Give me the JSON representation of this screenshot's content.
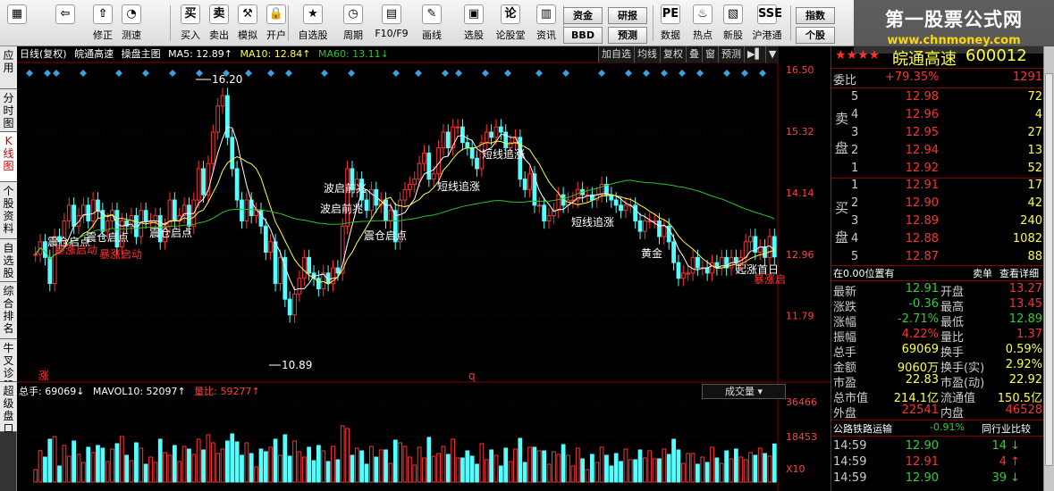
{
  "toolbar": {
    "items": [
      {
        "label": "",
        "icon": "windows-icon"
      },
      {
        "label": "",
        "icon": "back-arrow-icon"
      },
      {
        "label": "修正",
        "icon": "revise-icon"
      },
      {
        "label": "测速",
        "icon": "speedtest-icon"
      },
      {
        "label": "买入",
        "icon": "buy-icon"
      },
      {
        "label": "卖出",
        "icon": "sell-icon"
      },
      {
        "label": "模拟",
        "icon": "simulate-icon"
      },
      {
        "label": "开户",
        "icon": "lock-icon"
      },
      {
        "label": "自选股",
        "icon": "star-icon"
      },
      {
        "label": "周期",
        "icon": "clock-icon"
      },
      {
        "label": "F10/F9",
        "icon": "f10-icon"
      },
      {
        "label": "画线",
        "icon": "pen-icon"
      },
      {
        "label": "选股",
        "icon": "screen-icon"
      },
      {
        "label": "论股堂",
        "icon": "forum-icon"
      },
      {
        "label": "资讯",
        "icon": "news-icon"
      },
      {
        "label": "数据",
        "icon": "pe-icon"
      },
      {
        "label": "热点",
        "icon": "hot-icon"
      },
      {
        "label": "新股",
        "icon": "newstock-icon"
      },
      {
        "label": "沪港通",
        "icon": "sse-hk-icon"
      }
    ],
    "icon_glyphs": [
      "▦",
      "⇦",
      "⇧",
      "◔",
      "买",
      "卖",
      "⚒",
      "🔒",
      "★",
      "◷",
      "▤",
      "✎",
      "▣",
      "论",
      "▥",
      "PE",
      "♨",
      "▧",
      "SSE"
    ],
    "small_buttons": [
      "资金",
      "BBD",
      "研报",
      "预测",
      "指数",
      "个股"
    ]
  },
  "watermark": {
    "line1": "第一股票公式网",
    "line2": "www.chnmoney.com"
  },
  "left_tabs": [
    "应用",
    "分时图",
    "K线图",
    "个股资料",
    "自选股",
    "综合排名",
    "牛叉诊股",
    "超级盘口"
  ],
  "info_bar": {
    "period": "日线(复权)",
    "stock": "皖通高速",
    "template": "操盘主图",
    "ma5": "MA5: 12.89↑",
    "ma10": "MA10: 12.84↑",
    "ma60": "MA60: 13.11↓"
  },
  "chart_buttons": [
    "加自选",
    "均线",
    "复权",
    "叠",
    "窗",
    "预测",
    "▶▌",
    "▼"
  ],
  "price_axis": {
    "ticks": [
      "16.50",
      "15.32",
      "14.14",
      "12.96",
      "11.79"
    ]
  },
  "chart_data": {
    "type": "candlestick",
    "x": [
      1,
      2,
      3,
      4,
      5,
      6,
      7,
      8,
      9,
      10,
      11,
      12,
      13,
      14,
      15,
      16,
      17,
      18,
      19,
      20,
      21,
      22,
      23,
      24,
      25,
      26,
      27,
      28,
      29,
      30,
      31,
      32,
      33,
      34,
      35,
      36,
      37,
      38,
      39,
      40,
      41,
      42,
      43,
      44,
      45,
      46,
      47,
      48,
      49,
      50,
      51,
      52,
      53,
      54,
      55,
      56,
      57,
      58,
      59,
      60,
      61,
      62,
      63,
      64,
      65,
      66,
      67,
      68,
      69,
      70,
      71,
      72,
      73,
      74,
      75,
      76,
      77,
      78,
      79,
      80,
      81,
      82,
      83,
      84,
      85,
      86,
      87,
      88,
      89,
      90,
      91,
      92,
      93,
      94,
      95,
      96,
      97,
      98,
      99,
      100,
      101,
      102,
      103,
      104,
      105,
      106,
      107,
      108,
      109,
      110,
      111,
      112,
      113,
      114,
      115,
      116,
      117,
      118,
      119,
      120,
      121,
      122,
      123,
      124,
      125,
      126,
      127,
      128,
      129,
      130,
      131,
      132,
      133,
      134,
      135,
      136,
      137,
      138,
      139,
      140,
      141,
      142,
      143,
      144,
      145,
      146,
      147,
      148,
      149,
      150,
      151,
      152,
      153,
      154,
      155,
      156,
      157,
      158,
      159,
      160,
      161,
      162,
      163,
      164,
      165,
      166,
      167,
      168,
      169,
      170,
      171,
      172,
      173,
      174,
      175,
      176,
      177,
      178,
      179,
      180,
      181,
      182,
      183,
      184,
      185,
      186,
      187,
      188,
      189,
      190,
      191,
      192,
      193,
      194,
      195,
      196,
      197,
      198,
      199,
      200,
      201,
      202,
      203,
      204,
      205,
      206,
      207,
      208,
      209,
      210,
      211,
      212,
      213,
      214,
      215,
      216,
      217,
      218,
      219,
      220,
      221,
      222,
      223,
      224,
      225,
      226,
      227,
      228,
      229,
      230,
      231,
      232,
      233,
      234,
      235,
      236,
      237,
      238,
      239,
      240,
      241,
      242,
      243,
      244,
      245,
      246,
      247,
      248,
      249,
      250,
      251,
      252,
      253,
      254,
      255,
      256,
      257,
      258,
      259,
      260,
      261,
      262,
      263,
      264,
      265,
      266,
      267,
      268,
      269,
      270,
      271,
      272,
      273,
      274,
      275,
      276,
      277,
      278,
      279,
      280,
      281,
      282,
      283,
      284,
      285,
      286,
      287,
      288,
      289,
      290,
      291,
      292,
      293,
      294,
      295,
      296,
      297,
      298,
      299,
      300,
      301,
      302,
      303,
      304,
      305,
      306,
      307,
      308,
      309,
      310,
      311,
      312,
      313,
      314,
      315,
      316,
      317,
      318,
      319,
      320,
      321,
      322,
      323,
      324,
      325,
      326,
      327,
      328,
      329,
      330,
      331,
      332,
      333,
      334,
      335,
      336,
      337,
      338,
      339,
      340,
      341,
      342,
      343,
      344,
      345,
      346,
      347,
      348,
      349,
      350,
      351,
      352,
      353,
      354,
      355,
      356,
      357,
      358,
      359,
      360,
      361,
      362,
      363,
      364,
      365,
      366,
      367,
      368,
      369,
      370,
      371,
      372,
      373,
      374,
      375,
      376,
      377,
      378,
      379,
      380,
      381,
      382,
      383,
      384,
      385,
      386,
      387,
      388,
      389,
      390,
      391,
      392,
      393,
      394,
      395,
      396,
      397,
      398,
      399,
      400,
      401,
      402,
      403,
      404,
      405,
      406,
      407,
      408,
      409,
      410,
      411,
      412,
      413,
      414,
      415,
      416,
      417,
      418,
      419,
      420,
      421,
      422,
      423,
      424,
      425,
      426,
      427,
      428,
      429,
      430,
      431,
      432,
      433,
      434,
      435,
      436,
      437,
      438,
      439,
      440,
      441,
      442,
      443,
      444,
      445,
      446,
      447,
      448,
      449,
      450,
      451,
      452,
      453,
      454,
      455,
      456,
      457,
      458,
      459,
      460,
      461,
      462,
      463,
      464,
      465,
      466,
      467,
      468,
      469,
      470,
      471,
      472,
      473,
      474,
      475,
      476,
      477,
      478,
      479,
      480,
      481,
      482,
      483,
      484,
      485,
      486,
      487,
      488,
      489,
      490,
      491,
      492,
      493,
      494,
      495,
      496,
      497,
      498,
      499,
      500
    ],
    "closes": [
      12.96,
      13.2,
      12.9,
      12.4,
      13.3,
      13.2,
      13.6,
      13.9,
      13.5,
      13.7,
      13.9,
      13.6,
      14.0,
      13.8,
      13.4,
      13.6,
      13.8,
      13.1,
      13.6,
      13.5,
      13.7,
      13.3,
      13.8,
      13.6,
      13.6,
      13.7,
      13.2,
      13.5,
      14.0,
      13.6,
      13.7,
      13.9,
      13.5,
      14.0,
      14.6,
      14.1,
      14.7,
      15.3,
      15.8,
      16.0,
      15.2,
      14.6,
      14.0,
      13.6,
      14.0,
      13.7,
      13.8,
      13.5,
      13.0,
      13.2,
      12.4,
      12.9,
      12.1,
      11.8,
      12.2,
      12.5,
      12.9,
      12.6,
      12.5,
      12.3,
      12.6,
      12.4,
      12.7,
      12.6,
      13.5,
      14.6,
      14.2,
      14.4,
      14.0,
      13.8,
      14.2,
      13.9,
      14.0,
      13.6,
      13.8,
      13.2,
      14.0,
      14.2,
      14.3,
      14.4,
      14.7,
      14.9,
      14.4,
      14.5,
      15.0,
      15.3,
      15.0,
      15.4,
      15.4,
      15.1,
      15.0,
      14.8,
      14.6,
      15.1,
      15.3,
      15.2,
      15.4,
      15.3,
      15.0,
      15.1,
      15.2,
      14.4,
      14.2,
      14.5,
      13.9,
      13.9,
      13.6,
      13.7,
      13.8,
      14.1,
      13.9,
      14.0,
      14.0,
      14.2,
      14.1,
      14.1,
      14.0,
      14.1,
      14.3,
      14.1,
      14.0,
      13.9,
      13.8,
      13.9,
      13.9,
      13.6,
      13.4,
      13.6,
      13.6,
      13.6,
      13.3,
      13.5,
      13.2,
      12.8,
      12.5,
      12.6,
      12.6,
      12.9,
      12.7,
      12.7,
      12.6,
      12.8,
      12.7,
      12.9,
      12.7,
      12.9,
      12.8,
      12.9,
      13.2,
      13.3,
      13.0,
      13.1,
      12.9,
      13.3,
      12.91
    ]
  },
  "annotations": {
    "high_label": "16.20",
    "low_label": "10.89",
    "marks": [
      {
        "text": "震仓启点",
        "color": "#ffffff"
      },
      {
        "text": "暴涨启动",
        "color": "#ff3030"
      },
      {
        "text": "震仓启点",
        "color": "#ffffff"
      },
      {
        "text": "暴涨启动",
        "color": "#ff3030"
      },
      {
        "text": "震仓启点",
        "color": "#ffffff"
      },
      {
        "text": "波启前兆",
        "color": "#ffffff"
      },
      {
        "text": "波启前兆",
        "color": "#ffffff"
      },
      {
        "text": "震仓启点",
        "color": "#ffffff"
      },
      {
        "text": "短线追涨",
        "color": "#ffffff"
      },
      {
        "text": "短线追涨",
        "color": "#ffffff"
      },
      {
        "text": "短线追涨",
        "color": "#ffffff"
      },
      {
        "text": "黄金",
        "color": "#ffffff"
      },
      {
        "text": "起涨首日",
        "color": "#ffffff"
      },
      {
        "text": "暴涨启",
        "color": "#ff3030"
      },
      {
        "text": "涨",
        "color": "#ff3030"
      },
      {
        "text": "q",
        "color": "#ff3030"
      }
    ]
  },
  "volume": {
    "label": "总手: 69069↓",
    "mavol": "MAVOL10: 52097↑",
    "liangbi": "量比: 59277↑",
    "dropdown": "成交量",
    "ticks": [
      "36466",
      "18453",
      "X10"
    ]
  },
  "quote": {
    "stars": "★★★★",
    "name": "皖通高速",
    "code": "600012",
    "weibi_label": "委比",
    "weibi": "+79.35%",
    "weicha": "1291",
    "sell_label": "卖盘",
    "buy_label": "买盘",
    "sell": [
      [
        "5",
        "12.98",
        "72"
      ],
      [
        "4",
        "12.96",
        "4"
      ],
      [
        "3",
        "12.95",
        "27"
      ],
      [
        "2",
        "12.94",
        "13"
      ],
      [
        "1",
        "12.92",
        "52"
      ]
    ],
    "buy": [
      [
        "1",
        "12.91",
        "17"
      ],
      [
        "2",
        "12.90",
        "42"
      ],
      [
        "3",
        "12.89",
        "240"
      ],
      [
        "4",
        "12.88",
        "1082"
      ],
      [
        "5",
        "12.87",
        "88"
      ]
    ],
    "position": "在0.00位置有",
    "sell_single": "卖单",
    "detail": "查看详细",
    "stats": [
      [
        "最新",
        "12.91",
        "开盘",
        "13.27"
      ],
      [
        "涨跌",
        "-0.36",
        "最高",
        "13.45"
      ],
      [
        "涨幅",
        "-2.71%",
        "最低",
        "12.89"
      ],
      [
        "振幅",
        "4.22%",
        "量比",
        "1.37"
      ],
      [
        "总手",
        "69069",
        "换手",
        "0.59%"
      ],
      [
        "金额",
        "9060万",
        "换手(实)",
        "2.92%"
      ],
      [
        "市盈",
        "22.83",
        "市盈(动)",
        "22.92"
      ],
      [
        "总市值",
        "214.1亿",
        "流通值",
        "150.5亿"
      ],
      [
        "外盘",
        "22541",
        "内盘",
        "46528"
      ]
    ],
    "sector": "公路铁路运输",
    "sector_change": "-0.91%",
    "peer": "同行业比较",
    "ticks": [
      [
        "14:59",
        "12.90",
        "14",
        "↓"
      ],
      [
        "14:59",
        "12.91",
        "4",
        "↑"
      ],
      [
        "14:59",
        "12.90",
        "39",
        "↓"
      ]
    ]
  }
}
